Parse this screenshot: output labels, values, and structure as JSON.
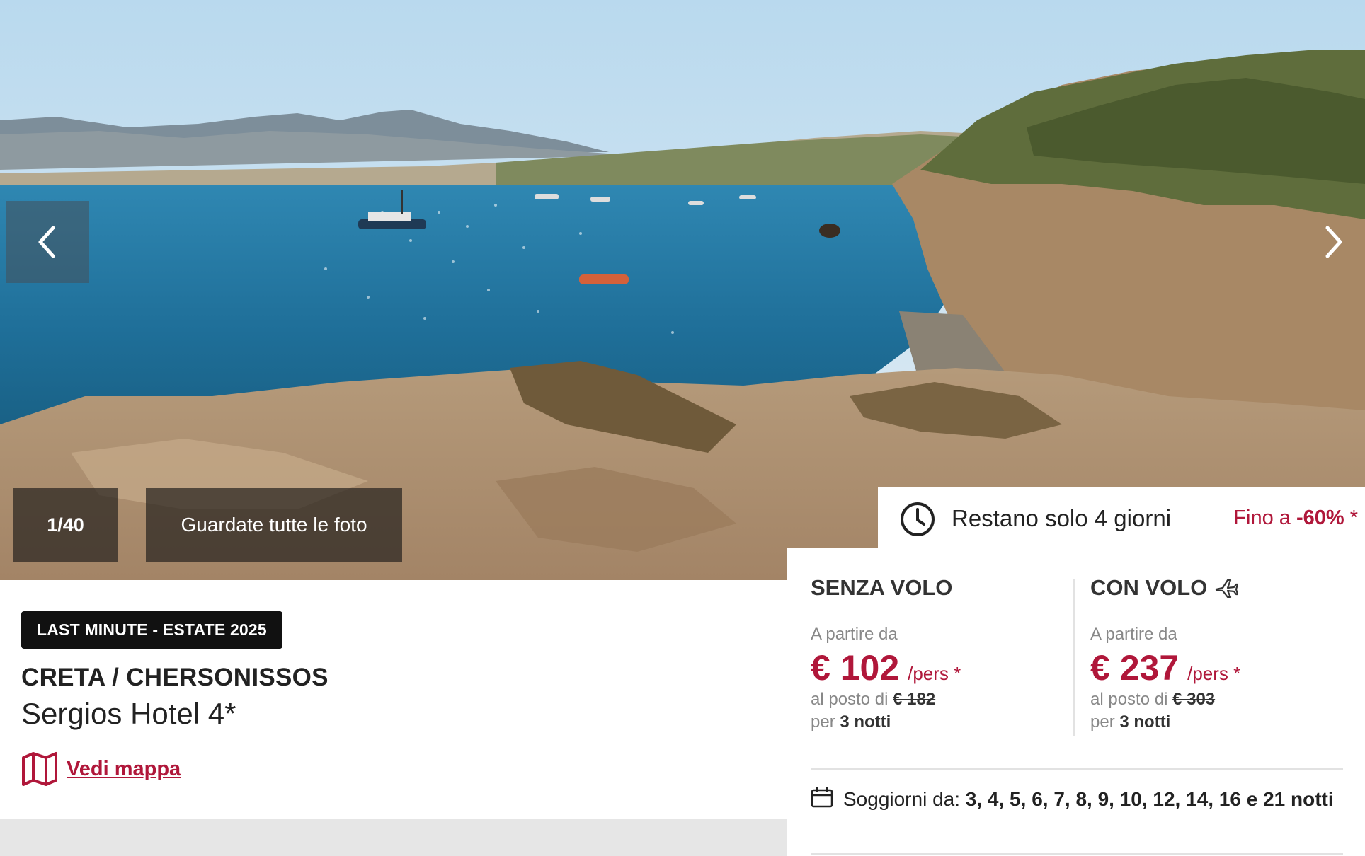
{
  "gallery": {
    "counter": "1/40",
    "all_photos_label": "Guardate tutte le foto",
    "prev_icon": "chevron-left-icon",
    "next_icon": "chevron-right-icon"
  },
  "offer": {
    "badge": "LAST MINUTE - ESTATE 2025",
    "destination": "CRETA / CHERSONISSOS",
    "hotel": "Sergios Hotel 4*",
    "map_link": "Vedi mappa"
  },
  "promo": {
    "timer_text": "Restano solo 4 giorni",
    "discount_prefix": "Fino a ",
    "discount_value": "-60%",
    "discount_suffix": " *"
  },
  "pricing": {
    "without_flight": {
      "title": "SENZA VOLO",
      "from_label": "A partire da",
      "price": "€ 102",
      "per_label": "/pers *",
      "old_label": "al posto di ",
      "old_price": "€ 182",
      "nights_prefix": "per ",
      "nights": "3 notti"
    },
    "with_flight": {
      "title": "CON VOLO",
      "from_label": "A partire da",
      "price": "€ 237",
      "per_label": "/pers *",
      "old_label": "al posto di ",
      "old_price": "€ 303",
      "nights_prefix": "per ",
      "nights": "3 notti"
    },
    "stays_label": "Soggiorni da: ",
    "stays_values": "3, 4, 5, 6, 7, 8, 9, 10, 12, 14, 16 e 21 notti"
  },
  "colors": {
    "accent": "#b0173a",
    "badge_bg": "#111111"
  }
}
